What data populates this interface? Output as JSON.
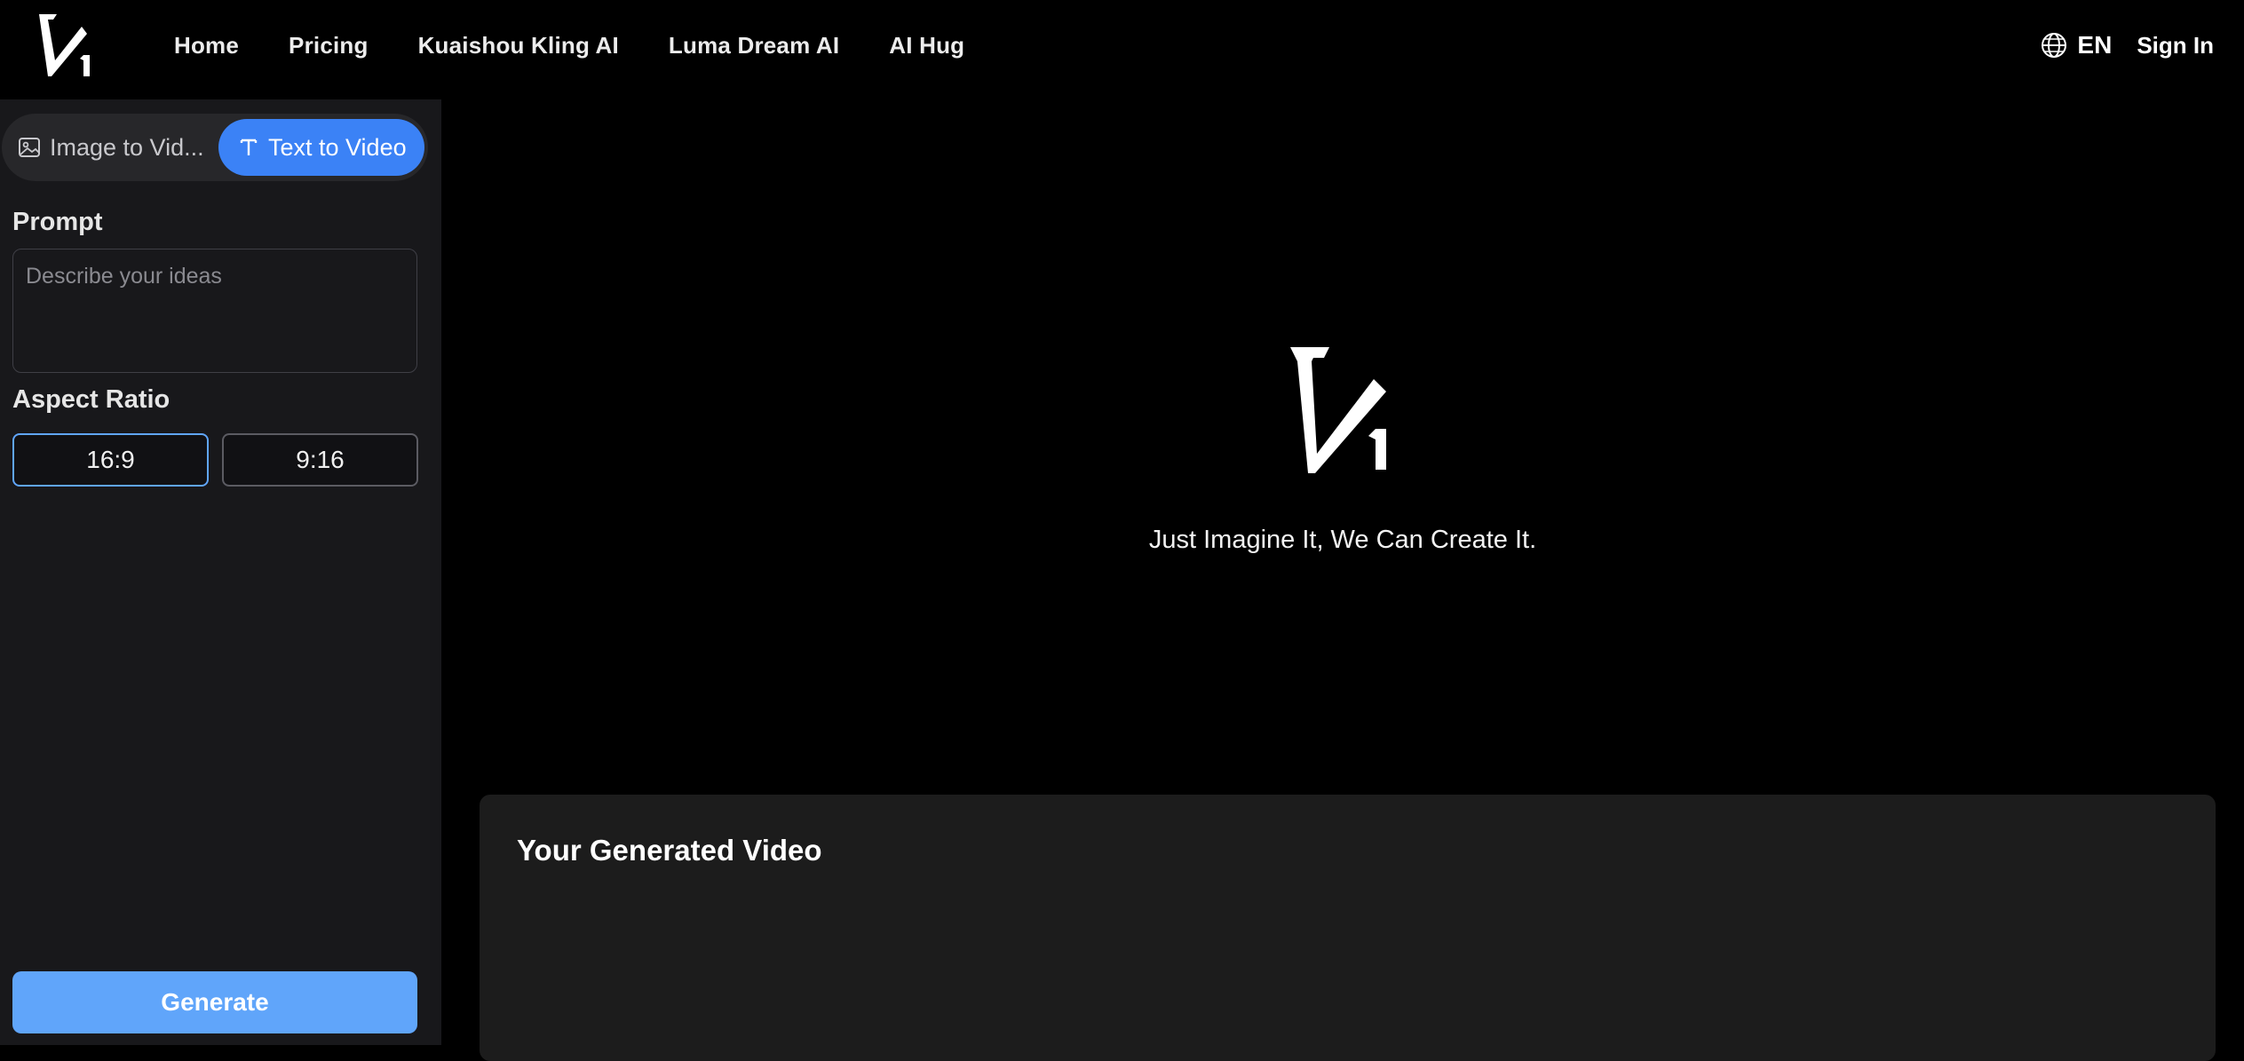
{
  "header": {
    "nav": [
      "Home",
      "Pricing",
      "Kuaishou Kling AI",
      "Luma Dream AI",
      "AI Hug"
    ],
    "language": "EN",
    "sign_in": "Sign In"
  },
  "sidebar": {
    "tabs": {
      "image_to_video": "Image to Vid...",
      "text_to_video": "Text to Video",
      "active": "Text to Video"
    },
    "prompt": {
      "label": "Prompt",
      "placeholder": "Describe your ideas",
      "value": ""
    },
    "aspect_ratio": {
      "label": "Aspect Ratio",
      "options": [
        "16:9",
        "9:16"
      ],
      "selected": "16:9"
    },
    "generate_label": "Generate"
  },
  "main": {
    "tagline": "Just Imagine It, We Can Create It.",
    "result_title": "Your Generated Video"
  },
  "colors": {
    "accent": "#3b82f6",
    "generate": "#60a5fa",
    "background": "#000000",
    "sidebar": "#18181b",
    "card": "#1c1c1c"
  },
  "icons": {
    "logo": "v1-logo",
    "language": "globe-icon",
    "image_tab": "image-icon",
    "text_tab": "text-icon"
  }
}
